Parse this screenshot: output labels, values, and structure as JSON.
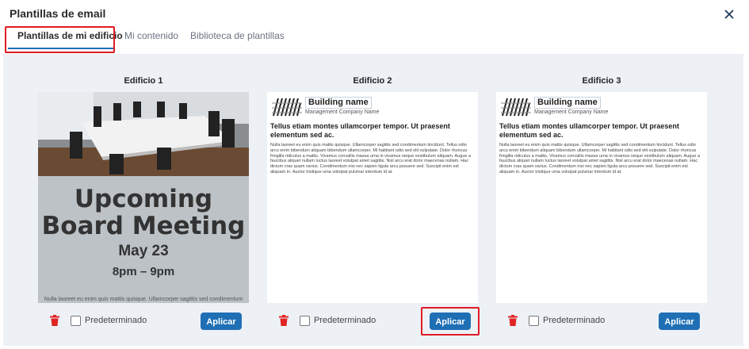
{
  "dialog": {
    "title": "Plantillas de email"
  },
  "tabs": [
    {
      "label": "Plantillas de mi edificio"
    },
    {
      "label": "Mi contenido"
    },
    {
      "label": "Biblioteca de plantillas"
    }
  ],
  "cards": [
    {
      "title": "Edificio 1",
      "poster": {
        "line1": "Upcoming",
        "line2": "Board Meeting",
        "date": "May 23",
        "time": "8pm – 9pm",
        "footer": "Nulla laoreet eu enim quis mattis quisque. Ullamcorper sagittis sed condimentum"
      },
      "checkbox_label": "Predeterminado",
      "apply_label": "Aplicar"
    },
    {
      "title": "Edificio 2",
      "newsletter": {
        "building_name": "Building name",
        "company": "Management Company Name",
        "headline": "Tellus etiam montes ullamcorper tempor. Ut praesent elementum sed ac.",
        "body": "Nulla laoreet eu enim quis mattis quisque. Ullamcorper sagittis sed condimentum tincidunt. Tellus odio arcu enim bibendum aliquam bibendum ullamcorper. Mi habitant odio sed elit vulputate. Dolor rhoncus fringilla ridiculus a mattis. Vivamus convallis massa urna in vivamus neque vestibulum aliquam. Augue a faucibus aliquet nullam luctus laoreet volutpat amet sagittis. Nisl arcu erat dolor maecenas nullam. Hac dictum cras quam varius. Condimentum nisi nec sapien ligula arcu posuere sed. Suscipit enim est aliquam in. Auctor tristique uma volutpat pulvinar interdum id at."
      },
      "checkbox_label": "Predeterminado",
      "apply_label": "Aplicar"
    },
    {
      "title": "Edificio 3",
      "newsletter": {
        "building_name": "Building name",
        "company": "Management Company Name",
        "headline": "Tellus etiam montes ullamcorper tempor. Ut praesent elementum sed ac.",
        "body": "Nulla laoreet eu enim quis mattis quisque. Ullamcorper sagittis sed condimentum tincidunt. Tellus odio arcu enim bibendum aliquam bibendum ullamcorper. Mi habitant odio sed elit vulputate. Dolor rhoncus fringilla ridiculus a mattis. Vivamus convallis massa urna in vivamus neque vestibulum aliquam. Augue a faucibus aliquet nullam luctus laoreet volutpat amet sagittis. Nisl arcu erat dolor maecenas nullam. Hac dictum cras quam varius. Condimentum nisi nec sapien ligula arcu posuere sed. Suscipit enim est aliquam in. Auctor tristique uma volutpat pulvinar interdum id at."
      },
      "checkbox_label": "Predeterminado",
      "apply_label": "Aplicar"
    }
  ],
  "icons": {
    "close": "close-icon",
    "delete": "trash-icon",
    "logo": "building-logo-icon"
  },
  "colors": {
    "accent": "#1f6fb5",
    "delete": "#e02424",
    "highlight": "#e01b24",
    "panel": "#edf1f6"
  }
}
